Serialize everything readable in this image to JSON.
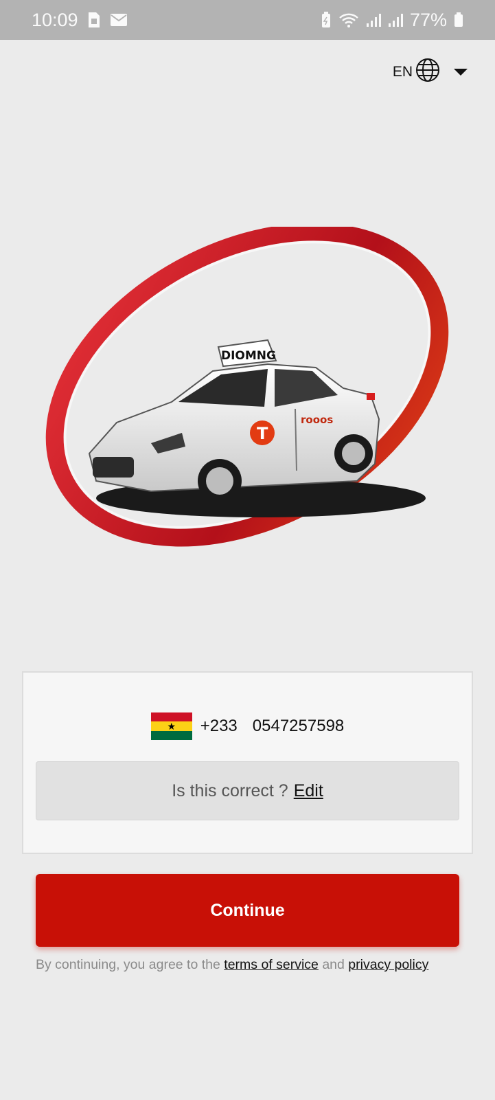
{
  "status_bar": {
    "time": "10:09",
    "battery": "77%",
    "icons": [
      "sim-card-icon",
      "mail-icon",
      "battery-saver-icon",
      "wifi-icon",
      "signal-icon",
      "signal-icon",
      "battery-icon"
    ]
  },
  "language": {
    "code": "EN",
    "icon": "globe-icon"
  },
  "hero": {
    "image": "taxi-car-with-red-swoosh-logo",
    "roof_sign": "DIOMNG",
    "door_badge": "T",
    "door_text": "rooos"
  },
  "phone": {
    "country_flag": "ghana-flag",
    "country_code": "+233",
    "number": "0547257598"
  },
  "confirm": {
    "question": "Is this correct ?",
    "edit_label": "Edit"
  },
  "continue_label": "Continue",
  "legal": {
    "prefix": "By continuing, you agree to the",
    "terms_label": "terms of service",
    "and": "and",
    "privacy_label": "privacy policy"
  },
  "colors": {
    "primary": "#c81006",
    "background": "#ebebeb",
    "status_bar": "#b3b3b3"
  }
}
